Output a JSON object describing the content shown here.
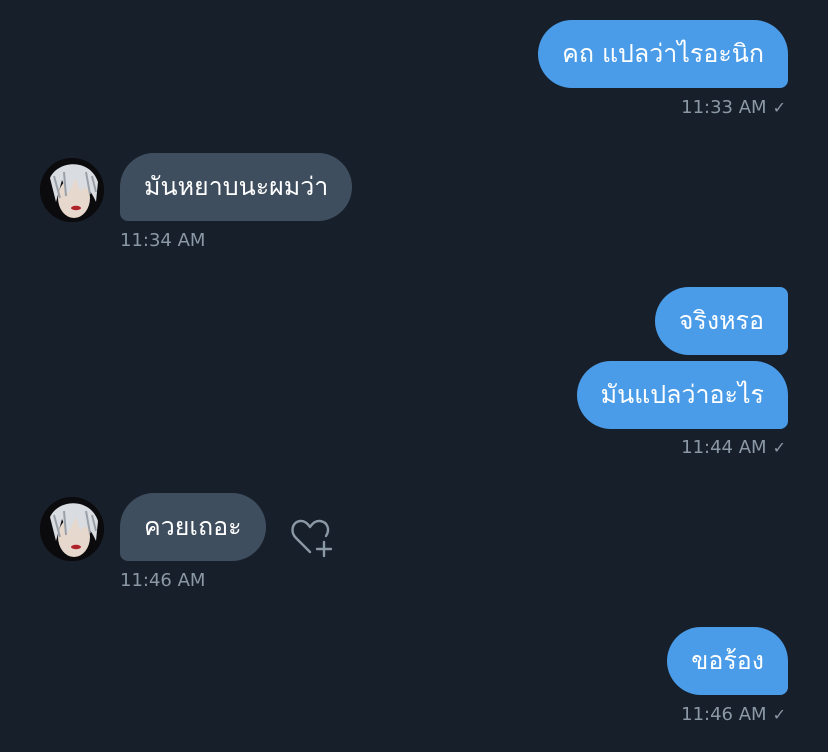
{
  "messages": [
    {
      "direction": "outgoing",
      "text": "คถ แปลว่าไรอะนิก"
    },
    {
      "direction": "incoming",
      "text": "มันหยาบนะผมว่า"
    },
    {
      "direction": "outgoing",
      "text": "จริงหรอ"
    },
    {
      "direction": "outgoing",
      "text": "มันแปลว่าอะไร"
    },
    {
      "direction": "incoming",
      "text": "ควยเถอะ"
    },
    {
      "direction": "outgoing",
      "text": "ขอร้อง"
    }
  ],
  "timestamps": {
    "t1": "11:33 AM",
    "t2": "11:34 AM",
    "t3": "11:44 AM",
    "t4": "11:46 AM",
    "t5": "11:46 AM"
  },
  "read_receipt_glyph": "✓",
  "icons": {
    "avatar": "user-avatar",
    "reaction": "heart-add-icon",
    "read": "checkmark-icon"
  },
  "colors": {
    "background": "#171f2a",
    "outgoing_bubble": "#4a9ce8",
    "incoming_bubble": "#3f4e5f",
    "timestamp": "#8b98a5"
  }
}
